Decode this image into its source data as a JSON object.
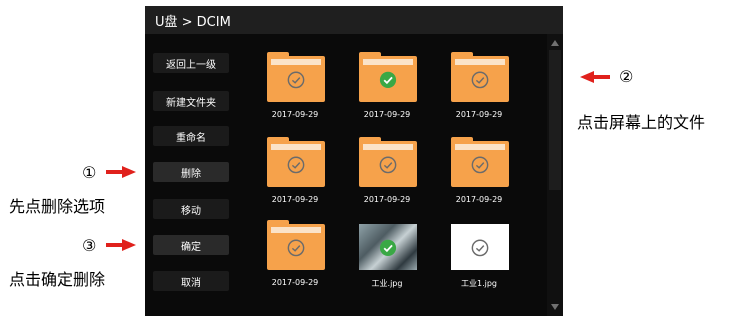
{
  "header": {
    "path": "U盘 > DCIM"
  },
  "sidebar": {
    "items": [
      {
        "label": "返回上一级"
      },
      {
        "label": "新建文件夹"
      },
      {
        "label": "重命名"
      },
      {
        "label": "删除"
      },
      {
        "label": "移动"
      },
      {
        "label": "确定"
      },
      {
        "label": "取消"
      }
    ]
  },
  "files": [
    {
      "name": "2017-09-29",
      "type": "folder",
      "selected": false
    },
    {
      "name": "2017-09-29",
      "type": "folder",
      "selected": true
    },
    {
      "name": "2017-09-29",
      "type": "folder",
      "selected": false
    },
    {
      "name": "2017-09-29",
      "type": "folder",
      "selected": false
    },
    {
      "name": "2017-09-29",
      "type": "folder",
      "selected": false
    },
    {
      "name": "2017-09-29",
      "type": "folder",
      "selected": false
    },
    {
      "name": "2017-09-29",
      "type": "folder",
      "selected": false
    },
    {
      "name": "工业.jpg",
      "type": "image",
      "selected": true
    },
    {
      "name": "工业1.jpg",
      "type": "image-blank",
      "selected": false
    }
  ],
  "annotations": {
    "step1_num": "①",
    "step1_text": "先点删除选项",
    "step2_num": "②",
    "step2_text": "点击屏幕上的文件",
    "step3_num": "③",
    "step3_text": "点击确定删除"
  },
  "colors": {
    "folder": "#f6a24b",
    "selected_check": "#3aa845",
    "arrow": "#e0211c"
  }
}
